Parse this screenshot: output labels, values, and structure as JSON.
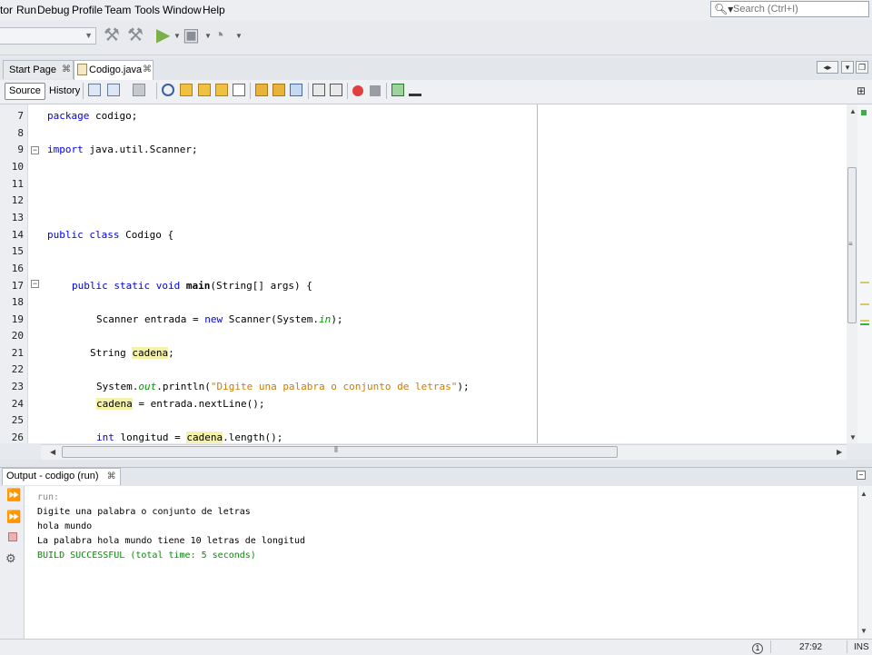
{
  "menu": {
    "items": [
      "tor",
      "Run",
      "Debug",
      "Profile",
      "Team",
      "Tools",
      "Window",
      "Help"
    ]
  },
  "search": {
    "placeholder": "Search (Ctrl+I)",
    "icon": "magnifier-icon"
  },
  "toolbar": {
    "icons": [
      "build-hammer-icon",
      "clean-build-icon",
      "run-icon",
      "debug-icon",
      "profile-icon"
    ]
  },
  "tabs": [
    {
      "label": "Start Page",
      "close": "⌘",
      "active": false
    },
    {
      "label": "Codigo.java",
      "close": "⌘",
      "active": true
    }
  ],
  "editor_toolbar": {
    "source_label": "Source",
    "history_label": "History"
  },
  "editor": {
    "lines": [
      {
        "n": "7"
      },
      {
        "n": "8"
      },
      {
        "n": "9"
      },
      {
        "n": "10"
      },
      {
        "n": "11"
      },
      {
        "n": "12"
      },
      {
        "n": "13"
      },
      {
        "n": "14"
      },
      {
        "n": "15"
      },
      {
        "n": "16"
      },
      {
        "n": "17"
      },
      {
        "n": "18"
      },
      {
        "n": "19"
      },
      {
        "n": "20"
      },
      {
        "n": "21"
      },
      {
        "n": "22"
      },
      {
        "n": "23"
      },
      {
        "n": "24"
      },
      {
        "n": "25"
      },
      {
        "n": "26"
      }
    ],
    "code": {
      "l7_kw": "package",
      "l7_rest": " codigo;",
      "l9_kw": "import",
      "l9_rest": " java.util.Scanner;",
      "l14_kw": "public class",
      "l14_rest": " Codigo {",
      "l17_kw": "public static void",
      "l17_name": " main",
      "l17_rest": "(String[] args) {",
      "l19_a": "Scanner entrada = ",
      "l19_kw": "new",
      "l19_b": " Scanner(System.",
      "l19_it": "in",
      "l19_c": ");",
      "l21_a": "String ",
      "l21_hl": "cadena",
      "l21_b": ";",
      "l23_a": "System.",
      "l23_it": "out",
      "l23_b": ".println(",
      "l23_str": "\"Digite una palabra o conjunto de letras\"",
      "l23_c": ");",
      "l24_hl": "cadena",
      "l24_rest": " = entrada.nextLine();",
      "l26_kw": "int",
      "l26_a": " longitud = ",
      "l26_hl": "cadena",
      "l26_b": ".length();"
    }
  },
  "output": {
    "tab_label": "Output - codigo (run)",
    "close": "⌘",
    "lines": [
      {
        "text": "run:",
        "color": "#888888"
      },
      {
        "text": "Digite una palabra o conjunto de letras",
        "color": "#000000"
      },
      {
        "text": "hola mundo",
        "color": "#000000"
      },
      {
        "text": "La palabra hola mundo tiene 10 letras de longitud",
        "color": "#000000"
      },
      {
        "text": "BUILD SUCCESSFUL (total time: 5 seconds)",
        "color": "#0a8a0a"
      }
    ]
  },
  "status": {
    "notifications": "1",
    "position": "27:92",
    "mode": "INS"
  },
  "colors": {
    "keyword": "#0000e6",
    "string": "#ce7b00",
    "highlight": "#f4f1a8",
    "success": "#0a8a0a"
  }
}
